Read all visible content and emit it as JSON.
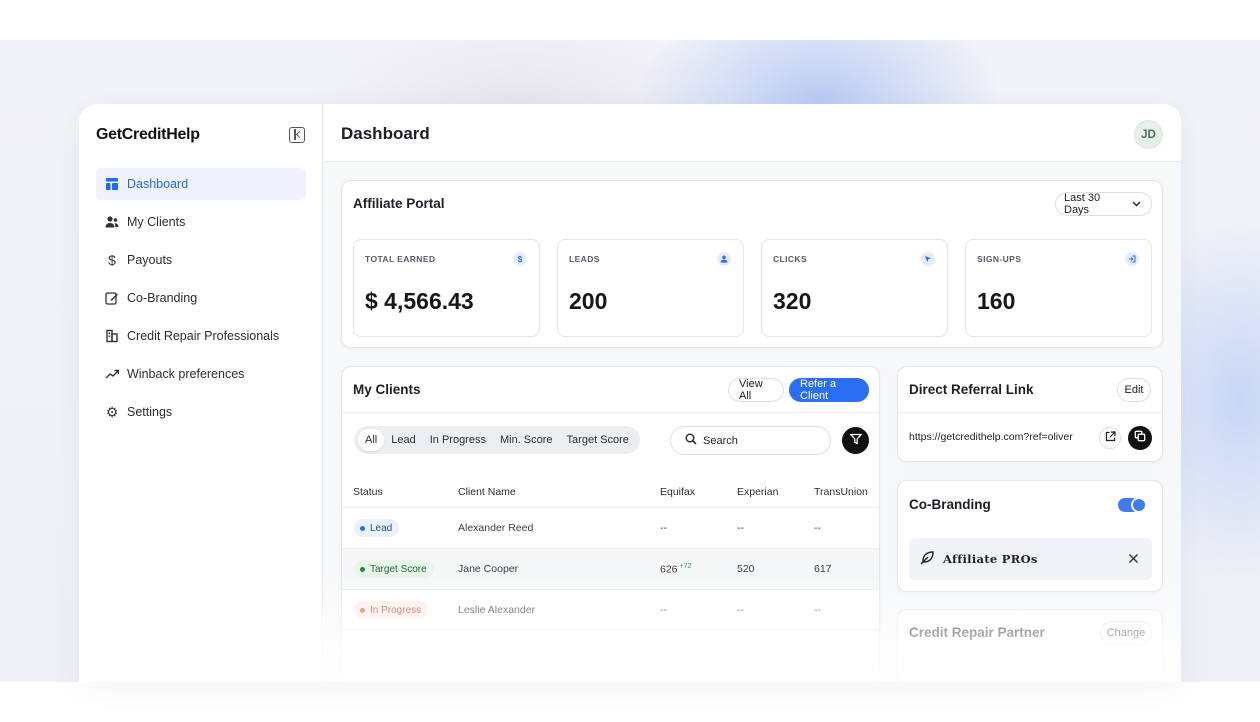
{
  "sidebar": {
    "brand": "GetCreditHelp",
    "items": [
      {
        "label": "Dashboard",
        "icon": "dashboard-icon",
        "active": true
      },
      {
        "label": "My Clients",
        "icon": "users-icon"
      },
      {
        "label": "Payouts",
        "icon": "dollar-icon"
      },
      {
        "label": "Co-Branding",
        "icon": "edit-icon"
      },
      {
        "label": "Credit Repair Professionals",
        "icon": "building-icon"
      },
      {
        "label": "Winback preferences",
        "icon": "trend-up-icon"
      },
      {
        "label": "Settings",
        "icon": "gear-icon"
      }
    ]
  },
  "header": {
    "title": "Dashboard",
    "avatar_initials": "JD"
  },
  "affiliate": {
    "title": "Affiliate Portal",
    "range_label": "Last 30 Days",
    "stats": [
      {
        "label": "TOTAL EARNED",
        "value": "$ 4,566.43",
        "icon": "dollar-icon"
      },
      {
        "label": "LEADS",
        "value": "200",
        "icon": "user-icon"
      },
      {
        "label": "CLICKS",
        "value": "320",
        "icon": "cursor-icon"
      },
      {
        "label": "SIGN-UPS",
        "value": "160",
        "icon": "sign-in-icon"
      }
    ]
  },
  "clients": {
    "title": "My Clients",
    "view_all": "View All",
    "refer": "Refer a Client",
    "filters": [
      "All",
      "Lead",
      "In Progress",
      "Min. Score",
      "Target Score"
    ],
    "search_placeholder": "Search",
    "columns": [
      "Status",
      "Client Name",
      "Equifax",
      "Experian",
      "TransUnion"
    ],
    "rows": [
      {
        "status": "Lead",
        "name": "Alexander Reed",
        "equifax": "--",
        "equifax_delta": "",
        "experian": "--",
        "transunion": "--"
      },
      {
        "status": "Target Score",
        "name": "Jane Cooper",
        "equifax": "626",
        "equifax_delta": "+72",
        "experian": "520",
        "transunion": "617"
      },
      {
        "status": "In Progress",
        "name": "Leslie Alexander",
        "equifax": "--",
        "equifax_delta": "",
        "experian": "--",
        "transunion": "--"
      }
    ]
  },
  "referral": {
    "title": "Direct Referral Link",
    "edit": "Edit",
    "url": "https://getcredithelp.com?ref=oliver"
  },
  "cobranding": {
    "title": "Co-Branding",
    "brand_name": "Affiliate PROs"
  },
  "partner": {
    "title": "Credit Repair Partner",
    "change": "Change"
  },
  "colors": {
    "accent": "#2b6ef2",
    "lead_bg": "#eaf1ff",
    "lead_dot": "#2b6ef2",
    "target_bg": "#e8f6ec",
    "target_dot": "#1f8b3a",
    "progress_bg": "#fdecea",
    "progress_dot": "#e0673e"
  }
}
